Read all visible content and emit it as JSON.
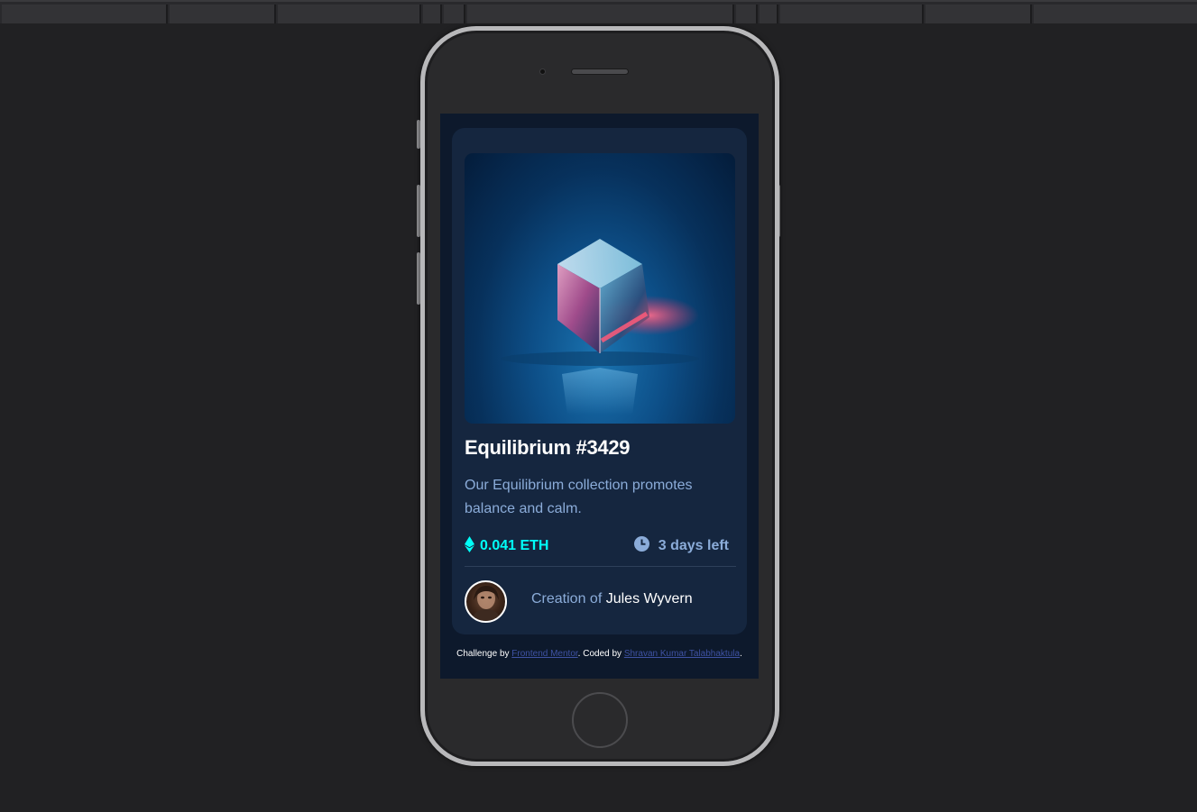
{
  "card": {
    "title": "Equilibrium #3429",
    "description": "Our Equilibrium collection promotes balance and calm.",
    "price": "0.041 ETH",
    "time_left": "3 days left",
    "creator_prefix": "Creation of",
    "creator_name": "Jules Wyvern"
  },
  "footer": {
    "challenge_prefix": "Challenge by",
    "challenge_link": "Frontend Mentor",
    "coded_prefix": ". Coded by",
    "coder_link": "Shravan Kumar Talabhaktula",
    "suffix": "."
  },
  "colors": {
    "page_bg": "#0d192c",
    "card_bg": "#15263f",
    "cyan": "#00fff8",
    "soft_blue": "#8bacd9",
    "white": "#ffffff",
    "link": "#3e52a3"
  },
  "icons": [
    "ethereum-icon",
    "clock-icon"
  ]
}
